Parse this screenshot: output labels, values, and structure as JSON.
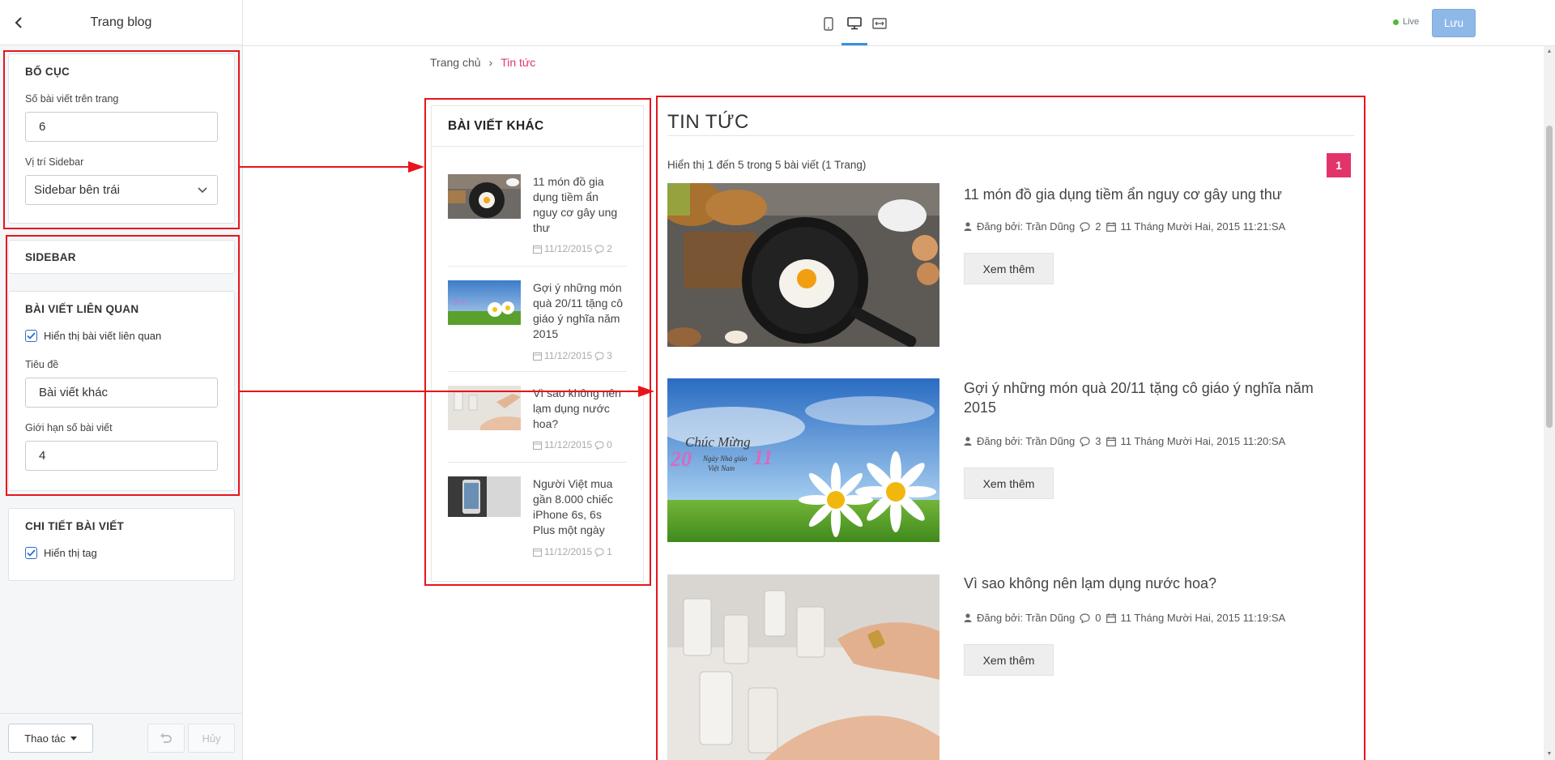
{
  "panel": {
    "title": "Trang blog",
    "layout": {
      "title": "BỐ CỤC",
      "posts_per_page_label": "Số bài viết trên trang",
      "posts_per_page_value": "6",
      "sidebar_position_label": "Vị trí Sidebar",
      "sidebar_position_value": "Sidebar bên trái"
    },
    "sidebar": {
      "title": "SIDEBAR"
    },
    "related": {
      "title": "BÀI VIẾT LIÊN QUAN",
      "show_related_label": "Hiển thị bài viết liên quan",
      "show_related_checked": true,
      "heading_label": "Tiêu đề",
      "heading_value": "Bài viết khác",
      "limit_label": "Giới hạn số bài viết",
      "limit_value": "4"
    },
    "detail": {
      "title": "CHI TIẾT BÀI VIẾT",
      "show_tag_label": "Hiển thị tag",
      "show_tag_checked": true
    },
    "footer": {
      "actions_label": "Thao tác",
      "cancel_label": "Hủy"
    }
  },
  "topbar": {
    "live_label": "Live",
    "save_label": "Lưu",
    "accent_color": "#3b8fe2"
  },
  "preview": {
    "breadcrumb": {
      "home": "Trang chủ",
      "separator": "›",
      "current": "Tin tức"
    },
    "sidebar": {
      "title": "BÀI VIẾT KHÁC",
      "items": [
        {
          "title": "11 món đồ gia dụng tiềm ẩn nguy cơ gây ung thư",
          "date": "11/12/2015",
          "comments": "2"
        },
        {
          "title": "Gợi ý những món quà 20/11 tặng cô giáo ý nghĩa năm 2015",
          "date": "11/12/2015",
          "comments": "3"
        },
        {
          "title": "Vì sao không nên lạm dụng nước hoa?",
          "date": "11/12/2015",
          "comments": "0"
        },
        {
          "title": "Người Việt mua gần 8.000 chiếc iPhone 6s, 6s Plus một ngày",
          "date": "11/12/2015",
          "comments": "1"
        }
      ]
    },
    "main": {
      "title": "TIN TỨC",
      "showing": "Hiển thị 1 đến 5 trong 5 bài viết (1 Trang)",
      "page": "1",
      "accent_color": "#e2336b",
      "articles": [
        {
          "title": "11 món đồ gia dụng tiềm ẩn nguy cơ gây ung thư",
          "author": "Đăng bởi: Trần Dũng",
          "comments": "2",
          "date": "11 Tháng Mười Hai, 2015 11:21:SA",
          "more": "Xem thêm"
        },
        {
          "title": "Gợi ý những món quà 20/11 tặng cô giáo ý nghĩa năm 2015",
          "author": "Đăng bởi: Trần Dũng",
          "comments": "3",
          "date": "11 Tháng Mười Hai, 2015 11:20:SA",
          "more": "Xem thêm",
          "image_text": {
            "line1": "Chúc Mừng",
            "day": "20",
            "month": "11",
            "line2": "Ngày Nhà giáo",
            "line3": "Việt Nam"
          }
        },
        {
          "title": "Vì sao không nên lạm dụng nước hoa?",
          "author": "Đăng bởi: Trần Dũng",
          "comments": "0",
          "date": "11 Tháng Mười Hai, 2015 11:19:SA",
          "more": "Xem thêm"
        }
      ]
    }
  },
  "annotation_color": "#e8141c"
}
